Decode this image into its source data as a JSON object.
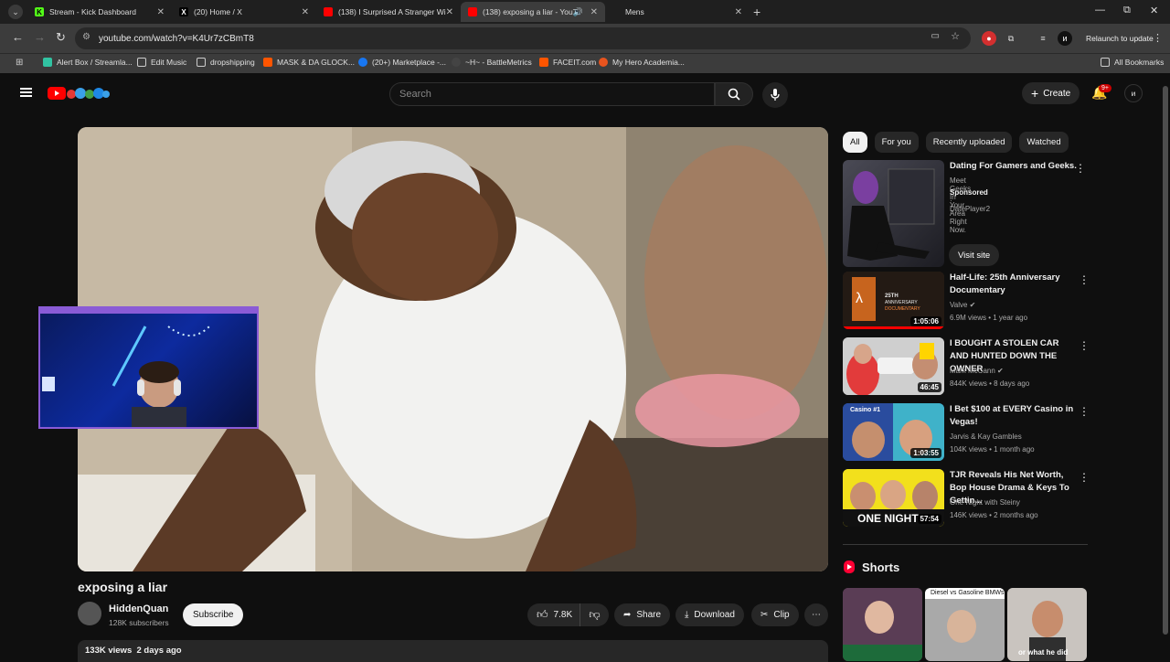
{
  "browser": {
    "tabs": [
      {
        "title": "Stream - Kick Dashboard",
        "favicon_label": "K",
        "favicon_color": "#53fc18"
      },
      {
        "title": "(20) Home / X",
        "favicon_label": "X",
        "favicon_color": "#000000"
      },
      {
        "title": "(138) I Surprised A Stranger Wi",
        "favicon_label": "",
        "favicon_color": "#ff0000"
      },
      {
        "title": "(138) exposing a liar - YouT",
        "favicon_label": "",
        "favicon_color": "#ff0000"
      },
      {
        "title": "Mens",
        "favicon_label": "",
        "favicon_color": ""
      }
    ],
    "url": "youtube.com/watch?v=K4Ur7zCBmT8",
    "relaunch_label": "Relaunch to update",
    "bookmarks": [
      {
        "label": "Alert Box / Streamla...",
        "color": "#31c3a2"
      },
      {
        "label": "Edit Music",
        "color": "folder"
      },
      {
        "label": "dropshipping",
        "color": "folder"
      },
      {
        "label": "MASK & DA GLOCK...",
        "color": "#ff5500"
      },
      {
        "label": "(20+) Marketplace -...",
        "color": "#1877f2"
      },
      {
        "label": "~H~ - BattleMetrics",
        "color": "#444444"
      },
      {
        "label": "FACEIT.com",
        "color": "#ff5500"
      },
      {
        "label": "My Hero Academia...",
        "color": "#e8541e"
      }
    ],
    "all_bookmarks_label": "All Bookmarks"
  },
  "youtube": {
    "search_placeholder": "Search",
    "create_label": "Create",
    "notif_badge": "9+",
    "video": {
      "title": "exposing a liar",
      "channel": "HiddenQuan",
      "subscribers": "128K subscribers",
      "subscribe_label": "Subscribe",
      "likes": "7.8K",
      "share_label": "Share",
      "download_label": "Download",
      "clip_label": "Clip",
      "views_date": "133K views  2 days ago"
    },
    "chips": [
      "All",
      "For you",
      "Recently uploaded",
      "Watched"
    ],
    "ad": {
      "title": "Dating For Gamers and Geeks.",
      "desc": "Meet Geeks In Your Area Right Now.",
      "sponsored": "Sponsored",
      "advertiser": "DatePlayer2",
      "cta": "Visit site"
    },
    "recommendations": [
      {
        "title": "Half-Life: 25th Anniversary Documentary",
        "channel": "Valve",
        "verified": true,
        "meta": "6.9M views • 1 year ago",
        "duration": "1:05:06",
        "thumb_color": "#3a2a1e"
      },
      {
        "title": "I BOUGHT A STOLEN CAR AND HUNTED DOWN THE OWNER",
        "channel": "Mark McCann",
        "verified": true,
        "meta": "844K views • 8 days ago",
        "duration": "46:45",
        "thumb_color": "#b9b9b9"
      },
      {
        "title": "I Bet $100 at EVERY Casino in Vegas!",
        "channel": "Jarvis & Kay Gambles",
        "verified": false,
        "meta": "104K views • 1 month ago",
        "duration": "1:03:55",
        "thumb_color": "#2f6bd0"
      },
      {
        "title": "TJR Reveals His Net Worth, Bop House Drama & Keys To Gettin...",
        "channel": "One Night with Steiny",
        "verified": false,
        "meta": "146K views • 2 months ago",
        "duration": "57:54",
        "thumb_color": "#e6d21a"
      }
    ],
    "shorts_heading": "Shorts",
    "shorts": [
      {
        "caption": "",
        "color": "#6b4b63"
      },
      {
        "caption": "Diesel vs Gasoline BMWs",
        "color": "#8f8f8f"
      },
      {
        "caption": "or what he did",
        "color": "#5e5a57"
      }
    ],
    "rec_thumb_labels": {
      "valve_line1": "25TH",
      "valve_line2": "ANNIVERSARY",
      "valve_line3": "DOCUMENTARY",
      "casino": "Casino #1",
      "onenight": "ONE NIGHT"
    }
  }
}
